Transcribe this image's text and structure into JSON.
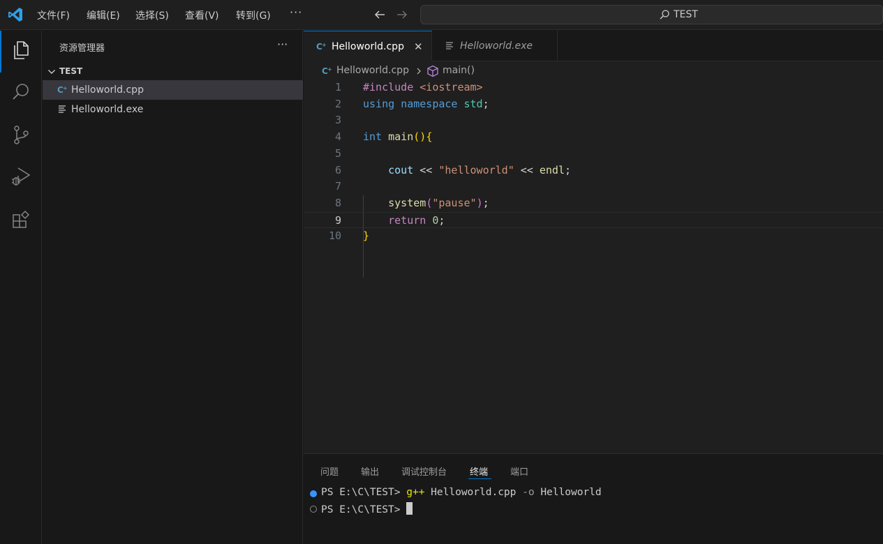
{
  "titlebar": {
    "menu": [
      "文件(F)",
      "编辑(E)",
      "选择(S)",
      "查看(V)",
      "转到(G)"
    ],
    "more": "···",
    "search": "TEST"
  },
  "sidebar": {
    "title": "资源管理器",
    "more": "···",
    "folder": "TEST",
    "files": [
      "Helloworld.cpp",
      "Helloworld.exe"
    ]
  },
  "editor": {
    "tabs": [
      {
        "label": "Helloworld.cpp",
        "close": "✕",
        "active": true
      },
      {
        "label": "Helloworld.exe",
        "active": false
      }
    ],
    "breadcrumb": {
      "file": "Helloworld.cpp",
      "symbol": "main()"
    },
    "line_numbers": [
      "1",
      "2",
      "3",
      "4",
      "5",
      "6",
      "7",
      "8",
      "9",
      "10"
    ],
    "current_line": 9,
    "code": {
      "l1_pre": "#include",
      "l1_hdr": "<iostream>",
      "l2_kw1": "using",
      "l2_kw2": "namespace",
      "l2_ns": "std",
      "l2_end": ";",
      "l4_type": "int",
      "l4_fn": "main",
      "l4_paren": "()",
      "l4_brace": "{",
      "l6_id": "cout",
      "l6_op1": "<<",
      "l6_str": "\"helloworld\"",
      "l6_op2": "<<",
      "l6_endl": "endl",
      "l6_end": ";",
      "l8_fn": "system",
      "l8_p1": "(",
      "l8_str": "\"pause\"",
      "l8_p2": ")",
      "l8_end": ";",
      "l9_kw": "return",
      "l9_num": "0",
      "l9_end": ";",
      "l10_brace": "}"
    }
  },
  "panel": {
    "tabs": [
      "问题",
      "输出",
      "调试控制台",
      "终端",
      "端口"
    ],
    "active_tab": "终端",
    "terminal": {
      "line1_prompt": "PS E:\\C\\TEST>",
      "line1_cmd": "g++",
      "line1_arg1": "Helloworld.cpp",
      "line1_flag": "-o",
      "line1_arg2": "Helloworld",
      "line2_prompt": "PS E:\\C\\TEST>"
    }
  },
  "colors": {
    "accent": "#0078d4",
    "success_dot": "#3794ff"
  }
}
